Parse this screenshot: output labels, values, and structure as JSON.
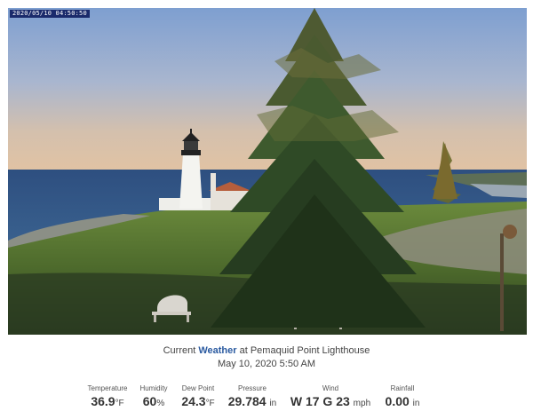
{
  "camera": {
    "timestamp": "2020/05/10 04:50:50"
  },
  "headline": {
    "prefix": "Current",
    "accent": "Weather",
    "suffix": "at Pemaquid Point Lighthouse"
  },
  "date": "May 10, 2020 5:50 AM",
  "stats": {
    "temperature": {
      "label": "Temperature",
      "value": "36.9",
      "unit": "°F"
    },
    "humidity": {
      "label": "Humidity",
      "value": "60",
      "unit": "%"
    },
    "dewpoint": {
      "label": "Dew Point",
      "value": "24.3",
      "unit": "°F"
    },
    "pressure": {
      "label": "Pressure",
      "value": "29.784",
      "unit": "in"
    },
    "wind": {
      "label": "Wind",
      "value": "W 17 G 23",
      "unit": "mph"
    },
    "rainfall": {
      "label": "Rainfall",
      "value": "0.00",
      "unit": "in"
    }
  },
  "colors": {
    "accent": "#2a5aa0",
    "timestamp_bg": "#1a2a6b"
  }
}
